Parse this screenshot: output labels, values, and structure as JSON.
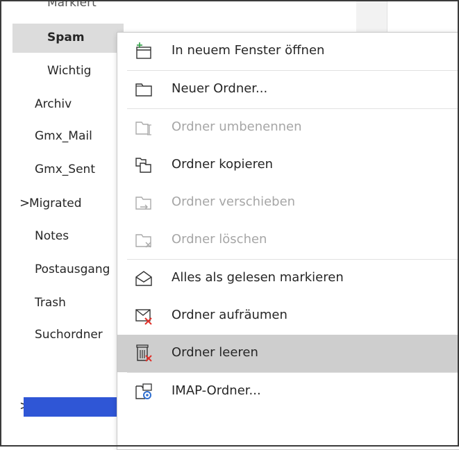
{
  "tree": {
    "partial_top_item": "Markiert",
    "folders": [
      {
        "label": "Spam",
        "selected": true
      },
      {
        "label": "Wichtig"
      },
      {
        "label": "Archiv"
      },
      {
        "label": "Gmx_Mail"
      },
      {
        "label": "Gmx_Sent"
      },
      {
        "label": "Migrated",
        "collapsed": true
      },
      {
        "label": "Notes"
      },
      {
        "label": "Postausgang"
      },
      {
        "label": "Trash"
      },
      {
        "label": "Suchordner"
      }
    ],
    "chevron_glyph": ">",
    "account_redacted_color": "#2f56d6"
  },
  "context_menu": {
    "items": [
      {
        "label": "In neuem Fenster öffnen",
        "enabled": true,
        "icon": "new-window-icon"
      },
      {
        "label": "Neuer Ordner...",
        "enabled": true,
        "icon": "new-folder-icon"
      },
      {
        "label": "Ordner umbenennen",
        "enabled": false,
        "icon": "rename-folder-icon"
      },
      {
        "label": "Ordner kopieren",
        "enabled": true,
        "icon": "copy-folder-icon"
      },
      {
        "label": "Ordner verschieben",
        "enabled": false,
        "icon": "move-folder-icon"
      },
      {
        "label": "Ordner löschen",
        "enabled": false,
        "icon": "delete-folder-icon"
      },
      {
        "label": "Alles als gelesen markieren",
        "enabled": true,
        "icon": "mark-read-icon"
      },
      {
        "label": "Ordner aufräumen",
        "enabled": true,
        "icon": "clean-up-folder-icon"
      },
      {
        "label": "Ordner leeren",
        "enabled": true,
        "hovered": true,
        "icon": "empty-folder-icon"
      },
      {
        "label": "IMAP-Ordner...",
        "enabled": true,
        "icon": "imap-folder-icon"
      }
    ]
  },
  "colors": {
    "accent_green": "#2e9e44",
    "accent_red": "#e0302a",
    "accent_blue": "#2f6fd1",
    "hover_bg": "#cecece",
    "selected_bg": "#dcdcdc"
  }
}
